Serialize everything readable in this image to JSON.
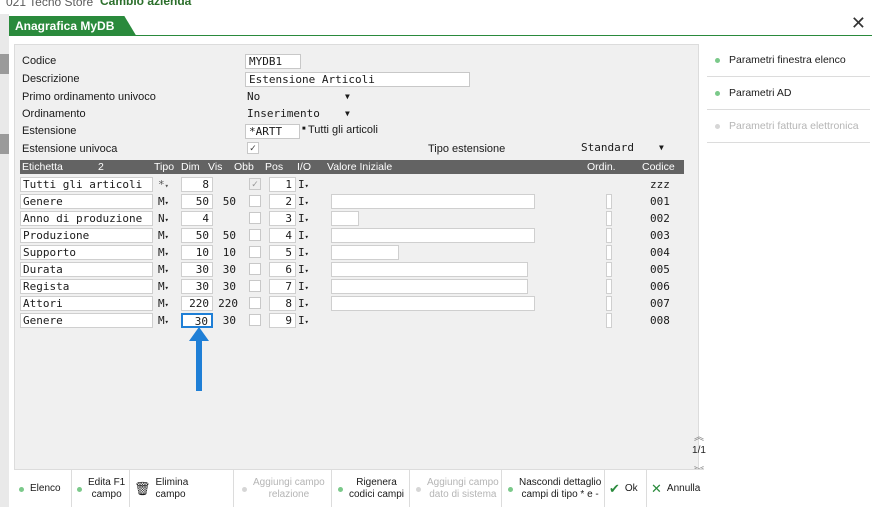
{
  "app": {
    "title_fragment": "021 Tecno Store",
    "company_button": "Cambio azienda"
  },
  "window": {
    "title": "Anagrafica MyDB"
  },
  "form": {
    "codice_label": "Codice",
    "codice_value": "MYDB1",
    "descrizione_label": "Descrizione",
    "descrizione_value": "Estensione Articoli",
    "primo_ord_label": "Primo ordinamento univoco",
    "primo_ord_value": "No",
    "ordinamento_label": "Ordinamento",
    "ordinamento_value": "Inserimento",
    "estensione_label": "Estensione",
    "estensione_value": "*ARTT",
    "estensione_desc": "Tutti gli articoli",
    "est_univoca_label": "Estensione univoca",
    "est_univoca_checked": "✓",
    "tipo_est_label": "Tipo estensione",
    "tipo_est_value": "Standard"
  },
  "grid": {
    "headers": {
      "etichetta": "Etichetta",
      "count": "2",
      "tipo": "Tipo",
      "dim": "Dim",
      "vis": "Vis",
      "obb": "Obb",
      "pos": "Pos",
      "io": "I/O",
      "valore": "Valore Iniziale",
      "ordin": "Ordin.",
      "codice": "Codice"
    },
    "rows": [
      {
        "etichetta": "Tutti gli articoli",
        "tipo": "*",
        "dim": "8",
        "vis": "",
        "pos": "1",
        "io": "I",
        "codice": "zzz"
      },
      {
        "etichetta": "Genere",
        "tipo": "M",
        "dim": "50",
        "vis": "50",
        "pos": "2",
        "io": "I",
        "codice": "001"
      },
      {
        "etichetta": "Anno di produzione",
        "tipo": "N",
        "dim": "4",
        "vis": "",
        "pos": "3",
        "io": "I",
        "codice": "002"
      },
      {
        "etichetta": "Produzione",
        "tipo": "M",
        "dim": "50",
        "vis": "50",
        "pos": "4",
        "io": "I",
        "codice": "003"
      },
      {
        "etichetta": "Supporto",
        "tipo": "M",
        "dim": "10",
        "vis": "10",
        "pos": "5",
        "io": "I",
        "codice": "004"
      },
      {
        "etichetta": "Durata",
        "tipo": "M",
        "dim": "30",
        "vis": "30",
        "pos": "6",
        "io": "I",
        "codice": "005"
      },
      {
        "etichetta": "Regista",
        "tipo": "M",
        "dim": "30",
        "vis": "30",
        "pos": "7",
        "io": "I",
        "codice": "006"
      },
      {
        "etichetta": "Attori",
        "tipo": "M",
        "dim": "220",
        "vis": "220",
        "pos": "8",
        "io": "I",
        "codice": "007"
      },
      {
        "etichetta": "Genere",
        "tipo": "M",
        "dim": "30",
        "vis": "30",
        "pos": "9",
        "io": "I",
        "codice": "008"
      }
    ],
    "page": "1/1"
  },
  "sidebar": {
    "items": [
      {
        "label": "Parametri finestra elenco",
        "enabled": true
      },
      {
        "label": "Parametri AD",
        "enabled": true
      },
      {
        "label": "Parametri fattura elettronica",
        "enabled": false
      }
    ]
  },
  "toolbar": {
    "elenco": "Elenco",
    "edita_f1_1": "Edita F1",
    "edita_f1_2": "campo",
    "elimina_1": "Elimina",
    "elimina_2": "campo",
    "agg_rel_1": "Aggiungi campo",
    "agg_rel_2": "relazione",
    "rigenera_1": "Rigenera",
    "rigenera_2": "codici campi",
    "agg_sis_1": "Aggiungi campo",
    "agg_sis_2": "dato di sistema",
    "nascondi_1": "Nascondi dettaglio",
    "nascondi_2": "campi di tipo * e -",
    "ok": "Ok",
    "annulla": "Annulla"
  },
  "colors": {
    "accent": "#2a8a3c",
    "grid_header": "#636363",
    "arrow": "#1f7fd6"
  }
}
